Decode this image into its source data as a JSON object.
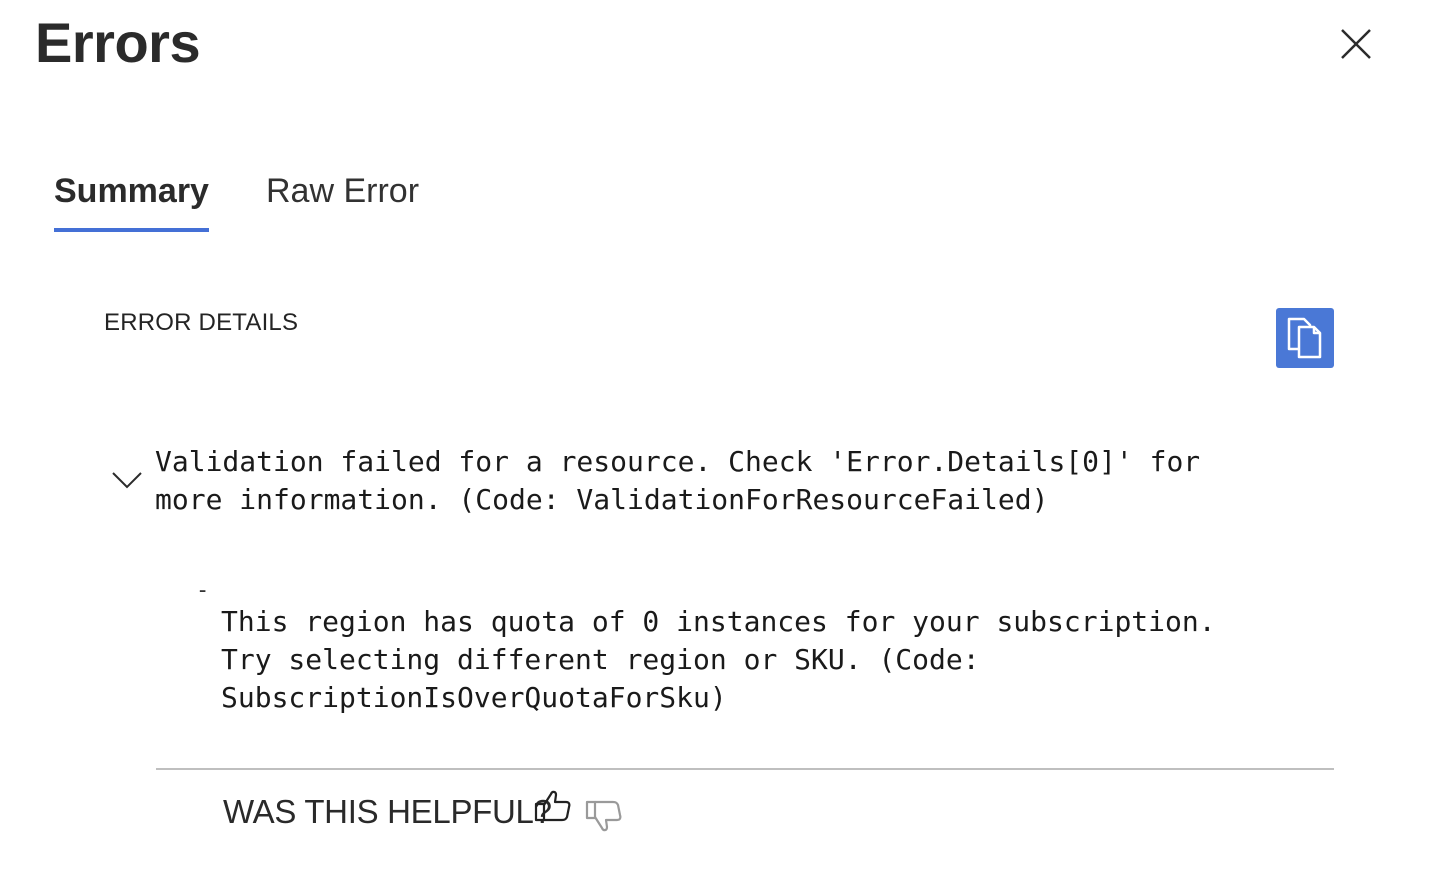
{
  "header": {
    "title": "Errors",
    "close_icon": "close-icon"
  },
  "tabs": [
    {
      "label": "Summary",
      "selected": true
    },
    {
      "label": "Raw Error",
      "selected": false
    }
  ],
  "details": {
    "section_label": "ERROR DETAILS",
    "copy_icon": "copy-icon",
    "accent_color": "#4a78d6",
    "main_error": {
      "expand_icon": "chevron-down-icon",
      "line1": "Validation failed for a resource. Check 'Error.Details[0]' for",
      "line2": "more information. (Code: ValidationForResourceFailed)"
    },
    "sub_error": {
      "bullet": "-",
      "line1": "This region has quota of 0 instances for your subscription.",
      "line2": "Try selecting different region or SKU. (Code:",
      "line3": "SubscriptionIsOverQuotaForSku)"
    }
  },
  "feedback": {
    "prompt": "WAS THIS HELPFUL?",
    "thumbs_up_icon": "thumbs-up-icon",
    "thumbs_down_icon": "thumbs-down-icon"
  }
}
